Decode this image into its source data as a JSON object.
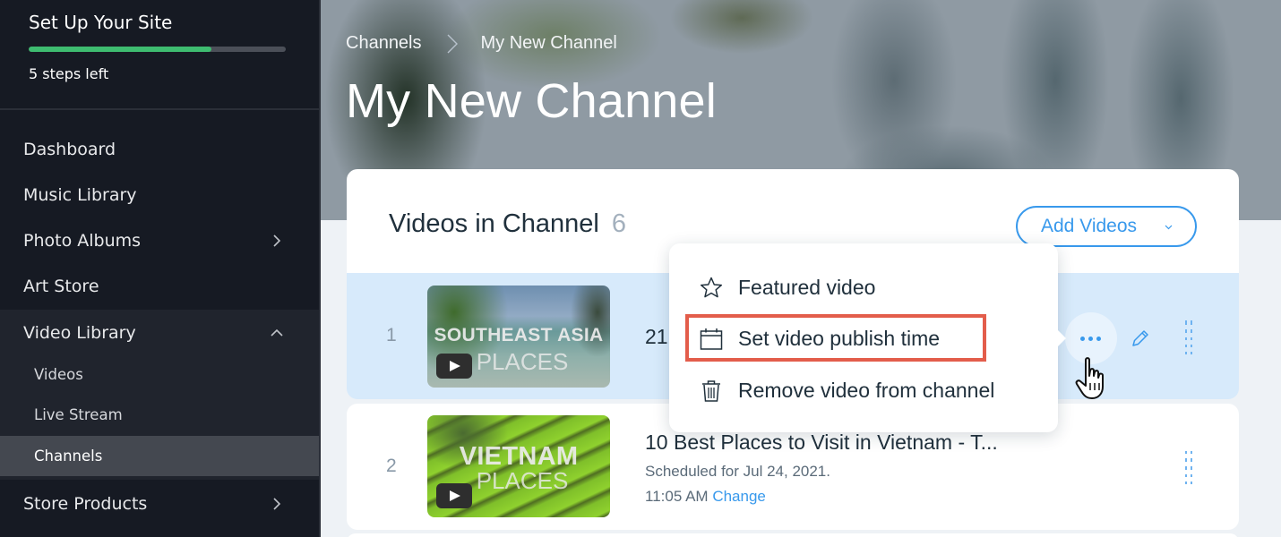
{
  "sidebar": {
    "setup": {
      "title": "Set Up Your Site",
      "progress_percent": 71,
      "subtitle": "5 steps left"
    },
    "items": [
      {
        "label": "Dashboard",
        "icon": null
      },
      {
        "label": "Music Library",
        "icon": null
      },
      {
        "label": "Photo Albums",
        "icon": "chevron-right-icon"
      },
      {
        "label": "Art Store",
        "icon": null
      },
      {
        "label": "Video Library",
        "icon": "chevron-up-icon",
        "expanded": true,
        "children": [
          {
            "label": "Videos"
          },
          {
            "label": "Live Stream"
          },
          {
            "label": "Channels",
            "active": true
          }
        ]
      },
      {
        "label": "Store Products",
        "icon": "chevron-right-icon"
      }
    ]
  },
  "header": {
    "breadcrumb": [
      "Channels",
      "My New Channel"
    ],
    "title": "My New Channel"
  },
  "card": {
    "title": "Videos in Channel",
    "count": "6",
    "add_button_label": "Add Videos"
  },
  "videos": [
    {
      "number": "1",
      "thumb_line1": "SOUTHEAST ASIA",
      "thumb_line2": "PLACES",
      "title_visible": "21",
      "selected": true
    },
    {
      "number": "2",
      "thumb_line1": "VIETNAM",
      "thumb_line2": "PLACES",
      "title": "10 Best Places to Visit in Vietnam - T...",
      "scheduled": "Scheduled for Jul 24, 2021.",
      "time": "11:05 AM",
      "change_label": "Change"
    }
  ],
  "menu": {
    "items": [
      {
        "label": "Featured video",
        "icon": "star-icon"
      },
      {
        "label": "Set video publish time",
        "icon": "calendar-icon",
        "highlighted": true
      },
      {
        "label": "Remove video from channel",
        "icon": "trash-icon"
      }
    ]
  },
  "colors": {
    "accent": "#3899ec",
    "progress": "#3ebc70",
    "highlight": "#e35d4b",
    "sidebar_bg": "#161a23",
    "selected_row": "#d7eafb"
  }
}
